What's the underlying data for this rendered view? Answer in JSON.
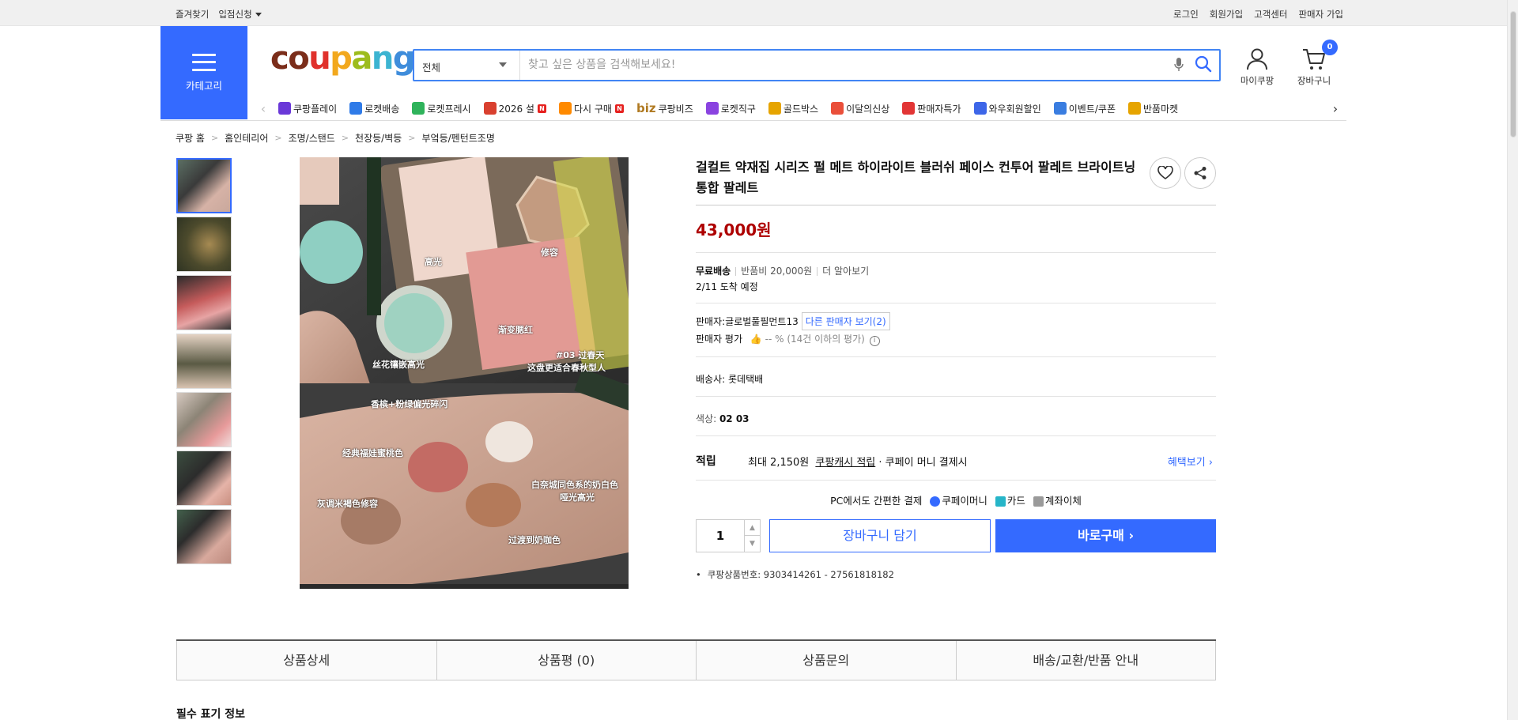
{
  "topbar": {
    "left": [
      "즐겨찾기",
      "입점신청"
    ],
    "right": [
      "로그인",
      "회원가입",
      "고객센터",
      "판매자 가입"
    ]
  },
  "header": {
    "category_label": "카테고리",
    "logo": "coupang",
    "search_category": "전체",
    "search_placeholder": "찾고 싶은 상품을 검색해보세요!",
    "mycoupang_label": "마이쿠팡",
    "cart_label": "장바구니",
    "cart_count": "0"
  },
  "services": [
    {
      "label": "쿠팡플레이",
      "color": "#6a38d8",
      "new": false
    },
    {
      "label": "로켓배송",
      "color": "#2f7be8",
      "new": false
    },
    {
      "label": "로켓프레시",
      "color": "#2fb35b",
      "new": false
    },
    {
      "label": "2026 설",
      "color": "#d9402f",
      "new": true
    },
    {
      "label": "다시 구매",
      "color": "#ff8a00",
      "new": true
    },
    {
      "label": "쿠팡비즈",
      "color": "#b07a22",
      "new": false,
      "prefix": "biz"
    },
    {
      "label": "로켓직구",
      "color": "#8a43e0",
      "new": false
    },
    {
      "label": "골드박스",
      "color": "#e6a400",
      "new": false
    },
    {
      "label": "이달의신상",
      "color": "#ea4f3a",
      "new": false
    },
    {
      "label": "판매자특가",
      "color": "#e23535",
      "new": false
    },
    {
      "label": "와우회원할인",
      "color": "#3d66e8",
      "new": false
    },
    {
      "label": "이벤트/쿠폰",
      "color": "#3a7de0",
      "new": false
    },
    {
      "label": "반품마켓",
      "color": "#e6a400",
      "new": false
    }
  ],
  "breadcrumb": [
    "쿠팡 홈",
    "홈인테리어",
    "조명/스탠드",
    "천장등/벽등",
    "부엌등/펜턴트조명"
  ],
  "image_labels": {
    "top1": "高光",
    "top2": "修容",
    "top3": "渐变腮红",
    "top4": "丝花镶嵌高光",
    "top5": "#03 过春天",
    "top6": "这盘更适合春秋型人",
    "b1": "香槟+粉绿偏光碎闪",
    "b2": "经典福娃蜜桃色",
    "b3": "白奈城同色系的奶白色",
    "b4": "哑光高光",
    "b5": "灰调米褐色修容",
    "b6": "过渡到奶咖色"
  },
  "product": {
    "title": "걸컬트 약재집 시리즈 펄 메트 하이라이트 블러쉬 페이스 컨투어 팔레트 브라이트닝 통합 팔레트",
    "price": "43,000원",
    "shipping_free": "무료배송",
    "return_fee": "반품비 20,000원",
    "more": "더 알아보기",
    "arrival": "2/11 도착 예정",
    "seller_label": "판매자:",
    "seller_name": "글로벌풀필먼트13",
    "other_sellers": "다른 판매자 보기(2)",
    "seller_rating_label": "판매자 평가",
    "seller_rating_value": "-- % (14건 이하의 평가)",
    "carrier_label": "배송사:",
    "carrier_name": "롯데택배",
    "color_label": "색상:",
    "color_value": "02 03",
    "benefit_label": "적립",
    "benefit_text_1": "최대 2,150원",
    "benefit_link": "쿠팡캐시 적립",
    "benefit_text_2": "· 쿠페이 머니 결제시",
    "benefit_more": "혜택보기",
    "pay_title": "PC에서도 간편한 결제",
    "pay_methods": [
      "쿠페이머니",
      "카드",
      "계좌이체"
    ],
    "quantity": "1",
    "add_to_cart": "장바구니 담기",
    "buy_now": "바로구매",
    "product_no": "쿠팡상품번호: 9303414261 - 27561818182"
  },
  "tabs": [
    "상품상세",
    "상품평 (0)",
    "상품문의",
    "배송/교환/반품 안내"
  ],
  "section_title": "필수 표기 정보",
  "colors": {
    "brand": "#346aff",
    "price": "#ae0000"
  }
}
